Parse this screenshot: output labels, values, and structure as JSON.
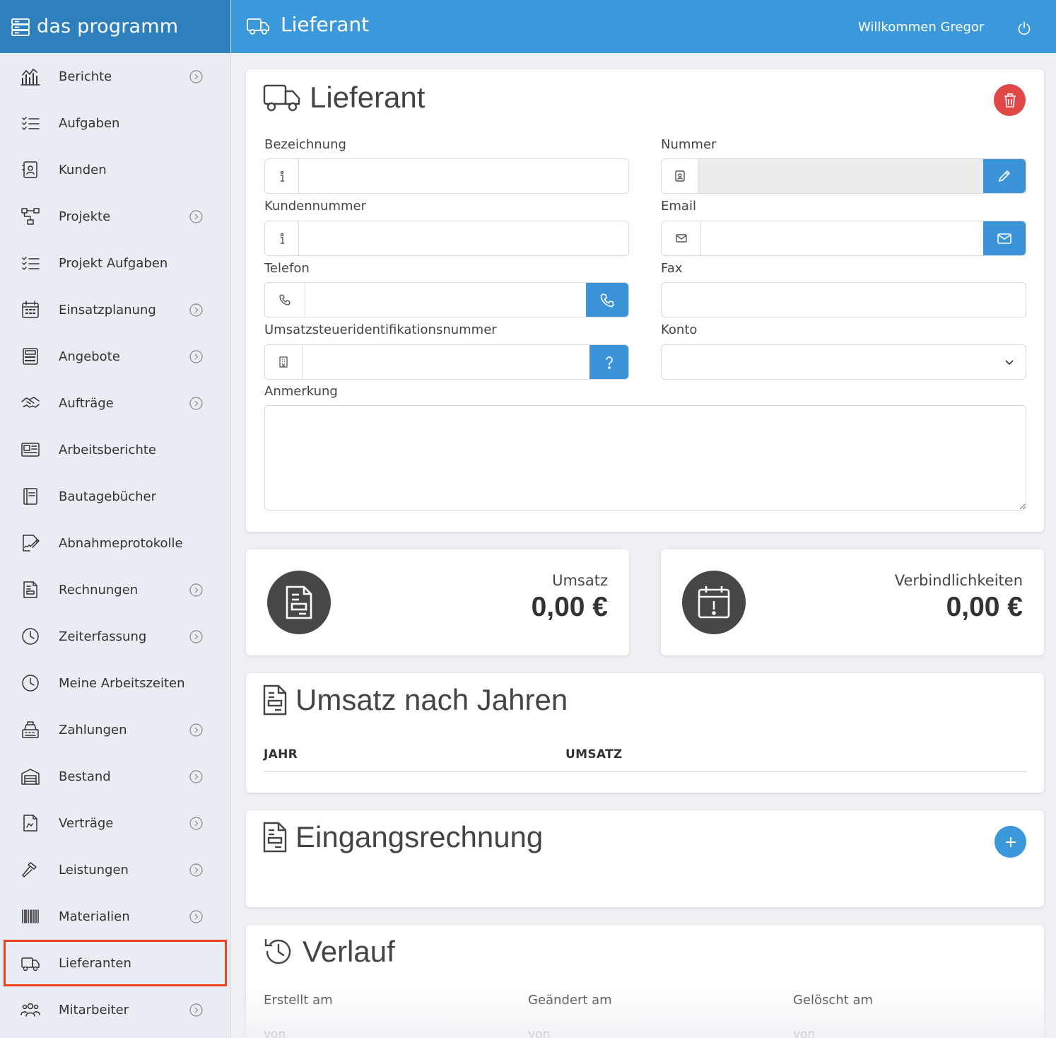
{
  "brand": {
    "title": "das programm",
    "icon": "server-icon"
  },
  "header": {
    "title": "Lieferant",
    "icon": "truck-icon",
    "welcome": "Willkommen Gregor",
    "logout_icon": "power-icon"
  },
  "sidebar": {
    "items": [
      {
        "label": "Berichte",
        "icon": "chart-icon",
        "has_submenu": true
      },
      {
        "label": "Aufgaben",
        "icon": "checklist-icon",
        "has_submenu": false
      },
      {
        "label": "Kunden",
        "icon": "contact-icon",
        "has_submenu": false
      },
      {
        "label": "Projekte",
        "icon": "project-tree-icon",
        "has_submenu": true
      },
      {
        "label": "Projekt Aufgaben",
        "icon": "checklist-icon",
        "has_submenu": false
      },
      {
        "label": "Einsatzplanung",
        "icon": "calendar-icon",
        "has_submenu": true
      },
      {
        "label": "Angebote",
        "icon": "calculator-icon",
        "has_submenu": true
      },
      {
        "label": "Aufträge",
        "icon": "handshake-icon",
        "has_submenu": true
      },
      {
        "label": "Arbeitsberichte",
        "icon": "newspaper-icon",
        "has_submenu": false
      },
      {
        "label": "Bautagebücher",
        "icon": "book-icon",
        "has_submenu": false
      },
      {
        "label": "Abnahmeprotokolle",
        "icon": "signature-icon",
        "has_submenu": false
      },
      {
        "label": "Rechnungen",
        "icon": "invoice-icon",
        "has_submenu": true
      },
      {
        "label": "Zeiterfassung",
        "icon": "clock-icon",
        "has_submenu": true
      },
      {
        "label": "Meine Arbeitszeiten",
        "icon": "clock-icon",
        "has_submenu": false
      },
      {
        "label": "Zahlungen",
        "icon": "cash-register-icon",
        "has_submenu": true
      },
      {
        "label": "Bestand",
        "icon": "warehouse-icon",
        "has_submenu": true
      },
      {
        "label": "Verträge",
        "icon": "contract-icon",
        "has_submenu": true
      },
      {
        "label": "Leistungen",
        "icon": "hammer-icon",
        "has_submenu": true
      },
      {
        "label": "Materialien",
        "icon": "barcode-icon",
        "has_submenu": true
      },
      {
        "label": "Lieferanten",
        "icon": "truck-icon",
        "has_submenu": false,
        "active": true
      },
      {
        "label": "Mitarbeiter",
        "icon": "users-icon",
        "has_submenu": true
      }
    ],
    "active_outline_color": "#ef4424"
  },
  "form": {
    "title": "Lieferant",
    "fields": {
      "bezeichnung": {
        "label": "Bezeichnung",
        "value": ""
      },
      "nummer": {
        "label": "Nummer",
        "value": ""
      },
      "kundennummer": {
        "label": "Kundennummer",
        "value": ""
      },
      "email": {
        "label": "Email",
        "value": ""
      },
      "telefon": {
        "label": "Telefon",
        "value": ""
      },
      "fax": {
        "label": "Fax",
        "value": ""
      },
      "ustid": {
        "label": "Umsatzsteueridentifikationsnummer",
        "value": ""
      },
      "konto": {
        "label": "Konto",
        "value": ""
      },
      "anmerkung": {
        "label": "Anmerkung",
        "value": ""
      }
    }
  },
  "stats": {
    "umsatz": {
      "label": "Umsatz",
      "value": "0,00 €",
      "icon": "invoice-icon"
    },
    "verbindlichkeiten": {
      "label": "Verbindlichkeiten",
      "value": "0,00 €",
      "icon": "calendar-alert-icon"
    }
  },
  "umsatz_jahre": {
    "title": "Umsatz nach Jahren",
    "columns": [
      "JAHR",
      "UMSATZ"
    ]
  },
  "eingangsrechnung": {
    "title": "Eingangsrechnung"
  },
  "verlauf": {
    "title": "Verlauf",
    "columns": [
      {
        "label": "Erstellt am",
        "sub": "von"
      },
      {
        "label": "Geändert am",
        "sub": "von"
      },
      {
        "label": "Gelöscht am",
        "sub": "von"
      }
    ]
  },
  "colors": {
    "primary": "#3b98db",
    "brand_bar": "#2e80bd",
    "danger": "#e04848",
    "stat_circle": "#474747"
  }
}
